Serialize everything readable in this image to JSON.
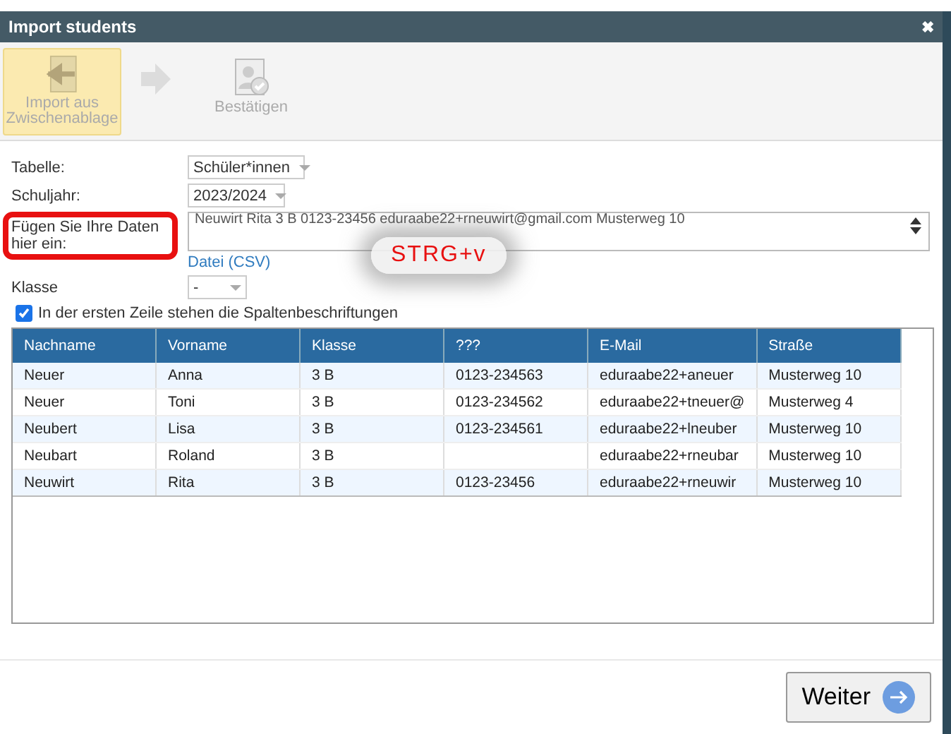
{
  "window": {
    "title": "Import students",
    "close": "✖"
  },
  "toolbar": [
    {
      "label": "Import aus Zwischenablage",
      "selected": true
    },
    {
      "label": "Bestätigen",
      "selected": false
    }
  ],
  "form": {
    "table_label": "Tabelle:",
    "table_value": "Schüler*innen",
    "year_label": "Schuljahr:",
    "year_value": "2023/2024",
    "paste_label": "Fügen Sie Ihre Daten hier ein:",
    "paste_value": "Neuwirt    Rita 3 B  0123-23456     eduraabe22+rneuwirt@gmail.com  Musterweg 10",
    "file_link": "Datei (CSV)",
    "class_label": "Klasse",
    "class_value": "-",
    "header_checkbox": {
      "label": "In der ersten Zeile stehen die Spaltenbeschriftungen",
      "checked": true
    }
  },
  "hint": "STRG+v",
  "table": {
    "columns": [
      "Nachname",
      "Vorname",
      "Klasse",
      "???",
      "E-Mail",
      "Straße"
    ],
    "rows": [
      [
        "Neuer",
        "Anna",
        "3 B",
        "0123-234563",
        "eduraabe22+aneuer",
        "Musterweg 10"
      ],
      [
        "Neuer",
        "Toni",
        "3 B",
        "0123-234562",
        "eduraabe22+tneuer@",
        "Musterweg 4"
      ],
      [
        "Neubert",
        "Lisa",
        "3 B",
        "0123-234561",
        "eduraabe22+lneuber",
        "Musterweg 10"
      ],
      [
        "Neubart",
        "Roland",
        "3 B",
        null,
        "eduraabe22+rneubar",
        "Musterweg 10"
      ],
      [
        "Neuwirt",
        "Rita",
        "3 B",
        "0123-23456",
        "eduraabe22+rneuwir",
        "Musterweg 10"
      ]
    ]
  },
  "footer": {
    "next_button": "Weiter"
  }
}
